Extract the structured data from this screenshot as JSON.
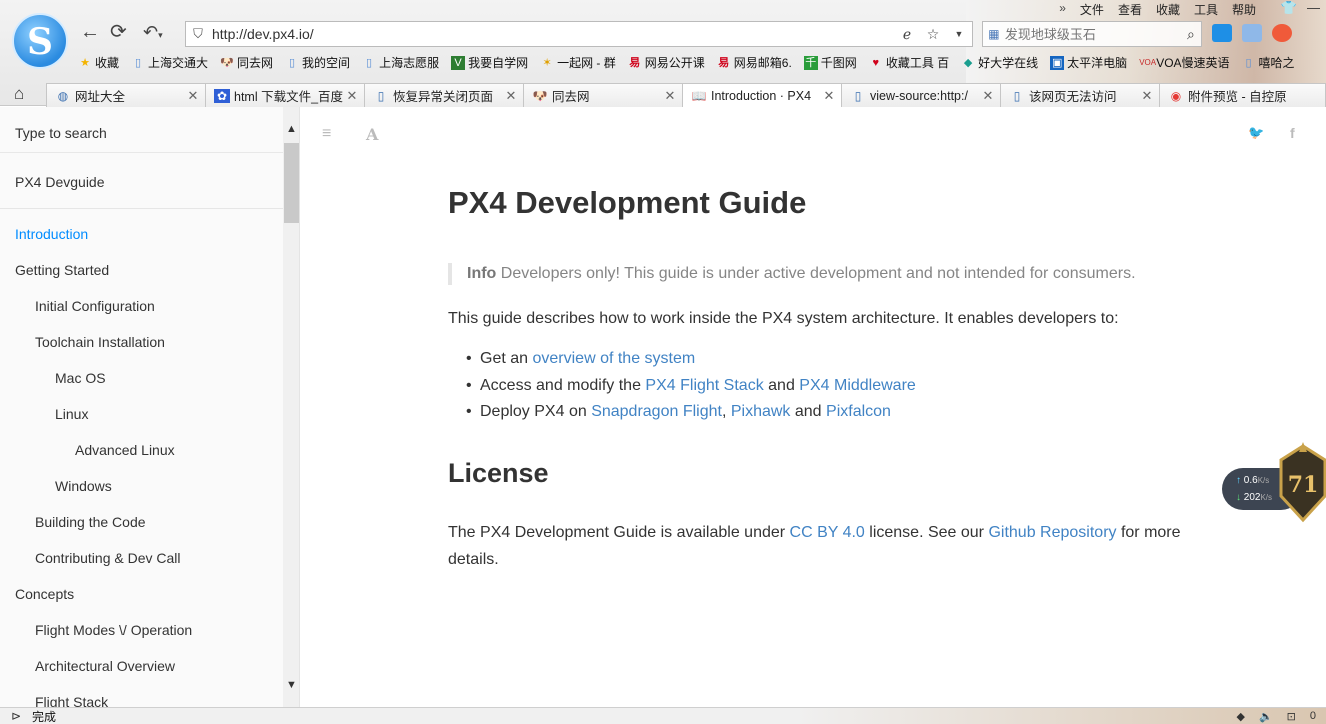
{
  "browser": {
    "menu": [
      "文件",
      "查看",
      "收藏",
      "工具",
      "帮助"
    ],
    "menu_overflow": "»",
    "url": "http://dev.px4.io/",
    "search_placeholder": "发现地球级玉石",
    "bookmarks": [
      {
        "label": "收藏",
        "icon": "star-icon"
      },
      {
        "label": "上海交通大",
        "icon": "page-icon"
      },
      {
        "label": "同去网",
        "icon": "dog-icon"
      },
      {
        "label": "我的空间",
        "icon": "page-icon"
      },
      {
        "label": "上海志愿服",
        "icon": "page-icon"
      },
      {
        "label": "我要自学网",
        "icon": "v-icon"
      },
      {
        "label": "一起网 - 群",
        "icon": "figure-icon"
      },
      {
        "label": "网易公开课",
        "icon": "netease-icon"
      },
      {
        "label": "网易邮箱6.",
        "icon": "netease-icon"
      },
      {
        "label": "千图网",
        "icon": "qiantu-icon"
      },
      {
        "label": "收藏工具 百",
        "icon": "heart-icon"
      },
      {
        "label": "好大学在线",
        "icon": "book-icon"
      },
      {
        "label": "太平洋电脑",
        "icon": "pconline-icon"
      },
      {
        "label": "VOA慢速英语",
        "icon": "voa-icon"
      },
      {
        "label": "嘻哈之",
        "icon": "page-icon"
      }
    ],
    "tabs": [
      {
        "label": "网址大全",
        "icon": "globe-icon"
      },
      {
        "label": "html 下载文件_百度",
        "icon": "baidu-icon"
      },
      {
        "label": "恢复异常关闭页面",
        "icon": "page-icon"
      },
      {
        "label": "同去网",
        "icon": "dog-icon"
      },
      {
        "label": "Introduction · PX4",
        "icon": "book-icon",
        "active": true
      },
      {
        "label": "view-source:http:/",
        "icon": "page-icon"
      },
      {
        "label": "该网页无法访问",
        "icon": "page-icon"
      },
      {
        "label": "附件预览 - 自控原",
        "icon": "chrome-icon"
      }
    ],
    "status_text": "完成",
    "status_right": [
      "0"
    ],
    "speed_up": "0.6",
    "speed_up_unit": "K/s",
    "speed_down": "202",
    "speed_down_unit": "K/s",
    "badge_value": "71"
  },
  "sidebar": {
    "search_placeholder": "Type to search",
    "book_title": "PX4 Devguide",
    "items": [
      {
        "label": "Introduction",
        "level": 0,
        "selected": true
      },
      {
        "label": "Getting Started",
        "level": 0
      },
      {
        "label": "Initial Configuration",
        "level": 1
      },
      {
        "label": "Toolchain Installation",
        "level": 1
      },
      {
        "label": "Mac OS",
        "level": 2
      },
      {
        "label": "Linux",
        "level": 2
      },
      {
        "label": "Advanced Linux",
        "level": 3
      },
      {
        "label": "Windows",
        "level": 2
      },
      {
        "label": "Building the Code",
        "level": 1
      },
      {
        "label": "Contributing & Dev Call",
        "level": 1
      },
      {
        "label": "Concepts",
        "level": 0
      },
      {
        "label": "Flight Modes \\/ Operation",
        "level": 1
      },
      {
        "label": "Architectural Overview",
        "level": 1
      },
      {
        "label": "Flight Stack",
        "level": 1
      }
    ]
  },
  "article": {
    "title": "PX4 Development Guide",
    "info_label": "Info",
    "info_text": " Developers only! This guide is under active development and not intended for consumers.",
    "intro": "This guide describes how to work inside the PX4 system architecture. It enables developers to:",
    "bullets": [
      {
        "parts": [
          {
            "t": "Get an "
          },
          {
            "t": "overview of the system",
            "link": true
          }
        ]
      },
      {
        "parts": [
          {
            "t": "Access and modify the "
          },
          {
            "t": "PX4 Flight Stack",
            "link": true
          },
          {
            "t": " and "
          },
          {
            "t": "PX4 Middleware",
            "link": true
          }
        ]
      },
      {
        "parts": [
          {
            "t": "Deploy PX4 on "
          },
          {
            "t": "Snapdragon Flight",
            "link": true
          },
          {
            "t": ", "
          },
          {
            "t": "Pixhawk",
            "link": true
          },
          {
            "t": " and "
          },
          {
            "t": "Pixfalcon",
            "link": true
          }
        ]
      }
    ],
    "license_heading": "License",
    "license_parts": [
      {
        "t": "The PX4 Development Guide is available under "
      },
      {
        "t": "CC BY 4.0",
        "link": true
      },
      {
        "t": " license. See our "
      },
      {
        "t": "Github Repository",
        "link": true
      },
      {
        "t": " for more details."
      }
    ]
  },
  "colors": {
    "link": "#4183c4",
    "selected": "#008cff"
  }
}
